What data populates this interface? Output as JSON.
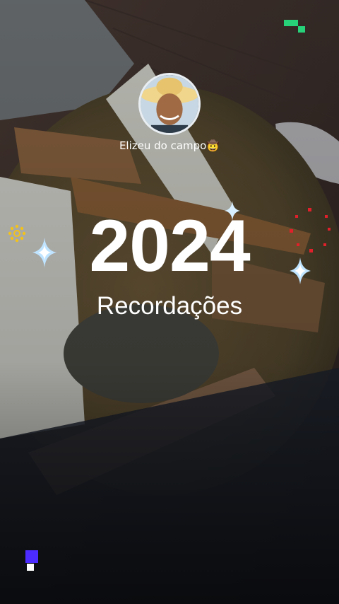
{
  "story": {
    "username": "Elizeu do campo🤠",
    "year": "2024",
    "subtitle": "Recordações"
  },
  "colors": {
    "accent_green": "#27d17a",
    "accent_purple": "#4b2bff",
    "accent_red": "#e0202a",
    "accent_yellow": "#f2c21b",
    "sparkle": "#bfe4ff"
  },
  "icons": [
    "avatar-photo",
    "sparkle-icon",
    "sun-icon",
    "pixel-blocks-icon"
  ]
}
